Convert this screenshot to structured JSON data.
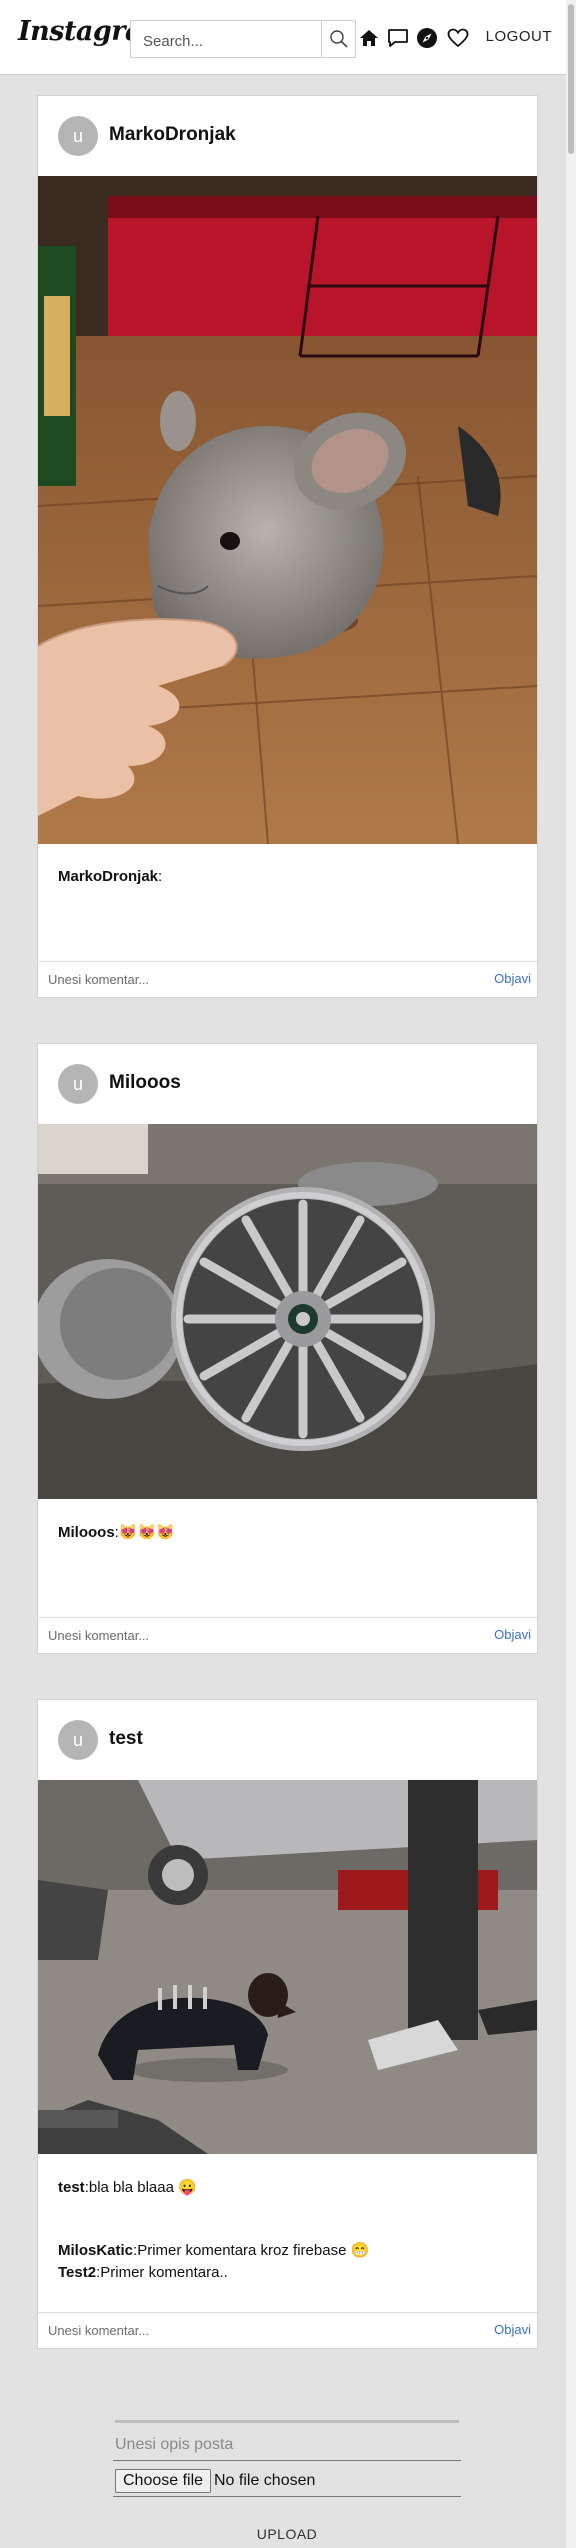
{
  "header": {
    "logo": "Instagram",
    "search_placeholder": "Search...",
    "logout_label": "LOGOUT"
  },
  "posts": [
    {
      "avatar_letter": "u",
      "username": "MarkoDronjak",
      "caption_user": "MarkoDronjak",
      "caption_text": "",
      "comments": [],
      "comment_placeholder": "Unesi komentar...",
      "post_label": "Objavi"
    },
    {
      "avatar_letter": "u",
      "username": "Milooos",
      "caption_user": "Milooos",
      "caption_text": "😻😻😻",
      "comments": [],
      "comment_placeholder": "Unesi komentar...",
      "post_label": "Objavi"
    },
    {
      "avatar_letter": "u",
      "username": "test",
      "caption_user": "test",
      "caption_text": "bla bla blaaa 😛",
      "comments": [
        {
          "user": "MilosKatic",
          "text": "Primer komentara kroz firebase 😁"
        },
        {
          "user": "Test2",
          "text": "Primer komentara.."
        }
      ],
      "comment_placeholder": "Unesi komentar...",
      "post_label": "Objavi"
    }
  ],
  "upload": {
    "description_placeholder": "Unesi opis posta",
    "choose_file_label": "Choose file",
    "no_file_text": "No file chosen",
    "upload_label": "UPLOAD"
  },
  "colors": {
    "accent_link": "#3a6fd0",
    "background": "#e2e2e2",
    "avatar": "#b5b5b5"
  },
  "icons": [
    "search-icon",
    "home-icon",
    "message-icon",
    "compass-icon",
    "heart-icon"
  ]
}
